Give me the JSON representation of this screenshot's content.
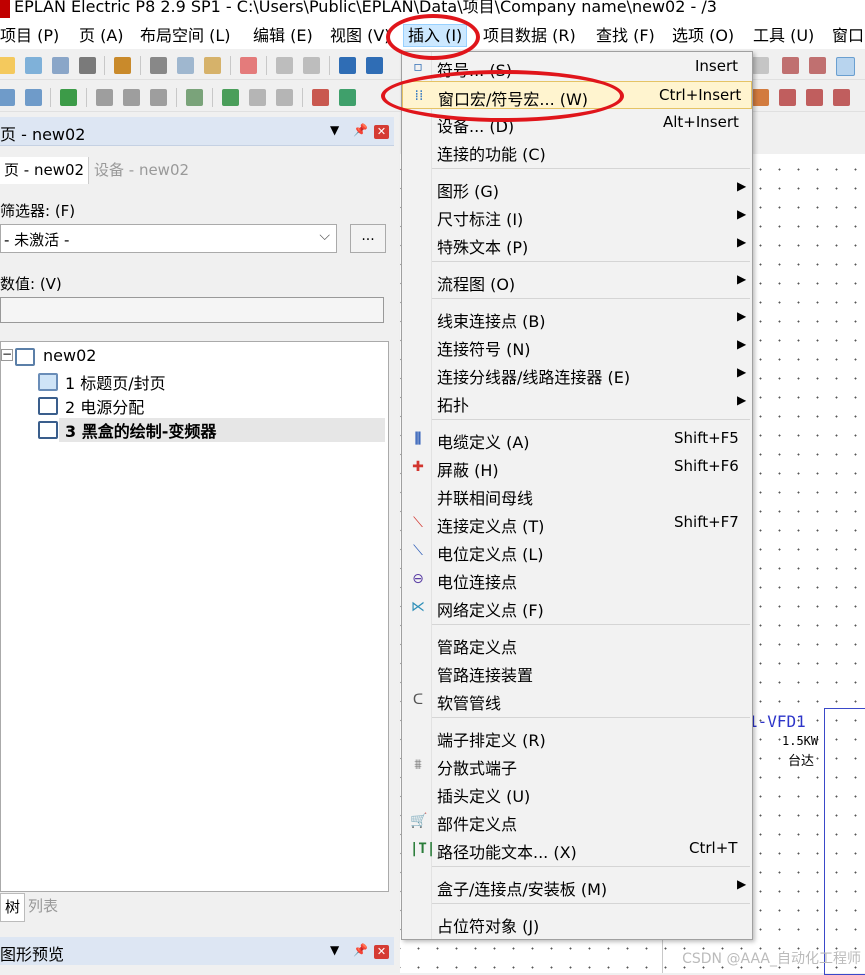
{
  "window": {
    "title": "EPLAN Electric P8 2.9 SP1 - C:\\Users\\Public\\EPLAN\\Data\\项目\\Company name\\new02 - /3"
  },
  "menubar": {
    "items": [
      {
        "label": "项目 (P)"
      },
      {
        "label": "页 (A)"
      },
      {
        "label": "布局空间 (L)"
      },
      {
        "label": "编辑 (E)"
      },
      {
        "label": "视图 (V)"
      },
      {
        "label": "插入 (I)"
      },
      {
        "label": "项目数据 (R)"
      },
      {
        "label": "查找 (F)"
      },
      {
        "label": "选项 (O)"
      },
      {
        "label": "工具 (U)"
      },
      {
        "label": "窗口"
      }
    ]
  },
  "page_navigator": {
    "title": "页 - new02",
    "tabs": [
      {
        "label": "页 - new02"
      },
      {
        "label": "设备 - new02"
      }
    ],
    "filter_label": "筛选器: (F)",
    "filter_value": "- 未激活 -",
    "value_label": "数值: (V)",
    "value_input": "",
    "tree": {
      "root": "new02",
      "pages": [
        {
          "label": "1 标题页/封页"
        },
        {
          "label": "2 电源分配"
        },
        {
          "label": "3 黑盒的绘制-变频器"
        }
      ]
    },
    "bottom_tabs": [
      {
        "label": "树"
      },
      {
        "label": "列表"
      }
    ],
    "preview_title": "图形预览"
  },
  "insert_menu": {
    "items": [
      {
        "label": "符号... (S)",
        "shortcut": "Insert"
      },
      {
        "label": "窗口宏/符号宏... (W)",
        "shortcut": "Ctrl+Insert"
      },
      {
        "label": "设备... (D)",
        "shortcut": "Alt+Insert"
      },
      {
        "label": "连接的功能 (C)",
        "shortcut": ""
      },
      {
        "label": "图形 (G)",
        "shortcut": ""
      },
      {
        "label": "尺寸标注 (I)",
        "shortcut": ""
      },
      {
        "label": "特殊文本 (P)",
        "shortcut": ""
      },
      {
        "label": "流程图 (O)",
        "shortcut": ""
      },
      {
        "label": "线束连接点 (B)",
        "shortcut": ""
      },
      {
        "label": "连接符号 (N)",
        "shortcut": ""
      },
      {
        "label": "连接分线器/线路连接器 (E)",
        "shortcut": ""
      },
      {
        "label": "拓扑",
        "shortcut": ""
      },
      {
        "label": "电缆定义 (A)",
        "shortcut": "Shift+F5"
      },
      {
        "label": "屏蔽 (H)",
        "shortcut": "Shift+F6"
      },
      {
        "label": "并联相间母线",
        "shortcut": ""
      },
      {
        "label": "连接定义点 (T)",
        "shortcut": "Shift+F7"
      },
      {
        "label": "电位定义点 (L)",
        "shortcut": ""
      },
      {
        "label": "电位连接点",
        "shortcut": ""
      },
      {
        "label": "网络定义点 (F)",
        "shortcut": ""
      },
      {
        "label": "管路定义点",
        "shortcut": ""
      },
      {
        "label": "管路连接装置",
        "shortcut": ""
      },
      {
        "label": "软管管线",
        "shortcut": ""
      },
      {
        "label": "端子排定义 (R)",
        "shortcut": ""
      },
      {
        "label": "分散式端子",
        "shortcut": ""
      },
      {
        "label": "插头定义 (U)",
        "shortcut": ""
      },
      {
        "label": "部件定义点",
        "shortcut": ""
      },
      {
        "label": "路径功能文本... (X)",
        "shortcut": "Ctrl+T"
      },
      {
        "label": "盒子/连接点/安装板 (M)",
        "shortcut": ""
      },
      {
        "label": "占位符对象 (J)",
        "shortcut": ""
      }
    ]
  },
  "canvas": {
    "device_tag": "-VFD1",
    "device_tag_prefix": "1",
    "power": "1.5KW",
    "qty_note": "台达"
  },
  "watermark": "CSDN @AAA_自动化工程师",
  "colors": {
    "highlight_ring": "#e0151b",
    "menu_highlight": "#fff4cf",
    "panel_title": "#dde6f3"
  }
}
